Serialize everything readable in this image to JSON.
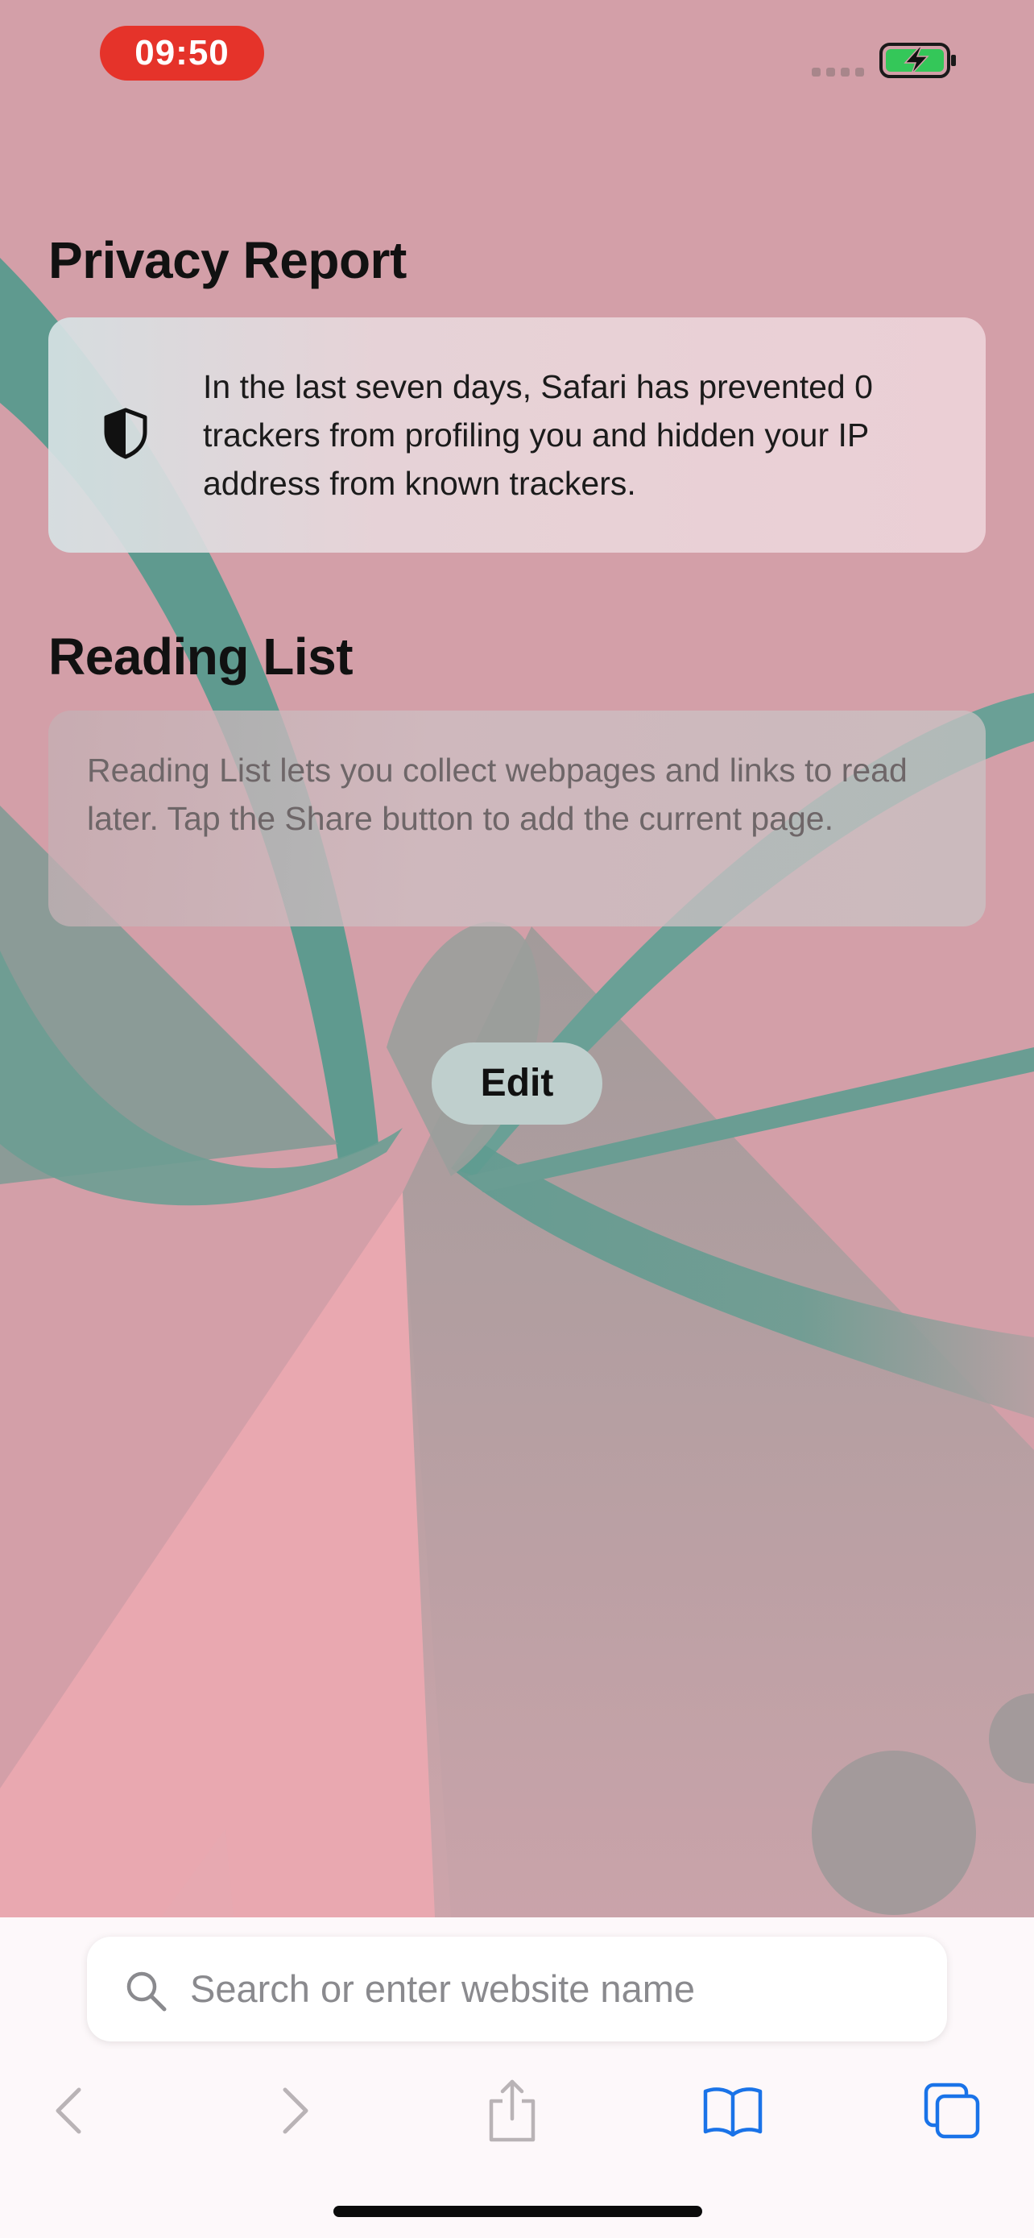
{
  "status_bar": {
    "time": "09:50",
    "battery_icon": "battery-charging-icon",
    "signal_icon": "signal-dots-icon"
  },
  "privacy_report": {
    "title": "Privacy Report",
    "icon": "shield-icon",
    "message": "In the last seven days, Safari has prevented 0 trackers from profiling you and hidden your IP address from known trackers."
  },
  "reading_list": {
    "title": "Reading List",
    "message": "Reading List lets you collect webpages and links to read later. Tap the Share button to add the current page."
  },
  "edit_label": "Edit",
  "search": {
    "placeholder": "Search or enter website name",
    "icon": "search-icon"
  },
  "toolbar": {
    "items": [
      "back-icon",
      "forward-icon",
      "share-icon",
      "bookmarks-icon",
      "tabs-icon"
    ]
  },
  "colors": {
    "accent": "#1a73e8",
    "time_pill": "#e5332a",
    "battery_fill": "#34c759",
    "disabled_icon": "#b9b3b6"
  }
}
